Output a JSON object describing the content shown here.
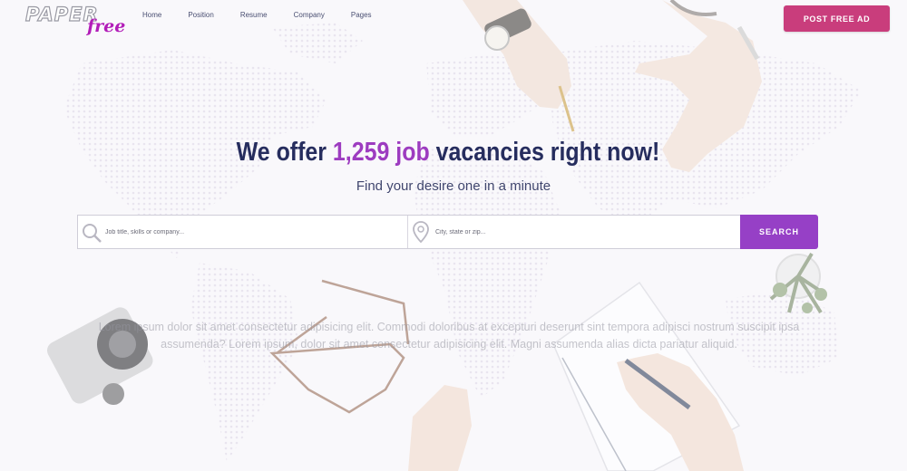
{
  "header": {
    "logo": {
      "wordmark": "PAPER",
      "tagline": "free"
    },
    "nav": [
      {
        "label": "Home"
      },
      {
        "label": "Position"
      },
      {
        "label": "Resume"
      },
      {
        "label": "Company"
      },
      {
        "label": "Pages"
      }
    ],
    "post_button_label": "POST FREE AD"
  },
  "hero": {
    "title_prefix": "We offer ",
    "title_count": "1,259",
    "title_job": " job",
    "title_suffix": " vacancies right now!",
    "subtitle": "Find your desire one in a minute"
  },
  "search": {
    "keyword": {
      "value": "",
      "placeholder": "Job title, skills or company..."
    },
    "location": {
      "value": "",
      "placeholder": "City, state or zip..."
    },
    "button_label": "SEARCH"
  },
  "description": "Lorem ipsum dolor sit amet consectetur adipisicing elit. Commodi doloribus at excepturi deserunt sint tempora adipisci nostrum suscipit ipsa assumenda? Lorem ipsum, dolor sit amet consectetur adipisicing elit. Magni assumenda alias dicta pariatur aliquid.",
  "colors": {
    "accent_purple": "#9640c6",
    "post_button": "#c93d7c",
    "title_navy": "#262d5e",
    "logo_tagline": "#b21db8"
  },
  "icons": [
    "search-icon",
    "location-pin-icon"
  ]
}
